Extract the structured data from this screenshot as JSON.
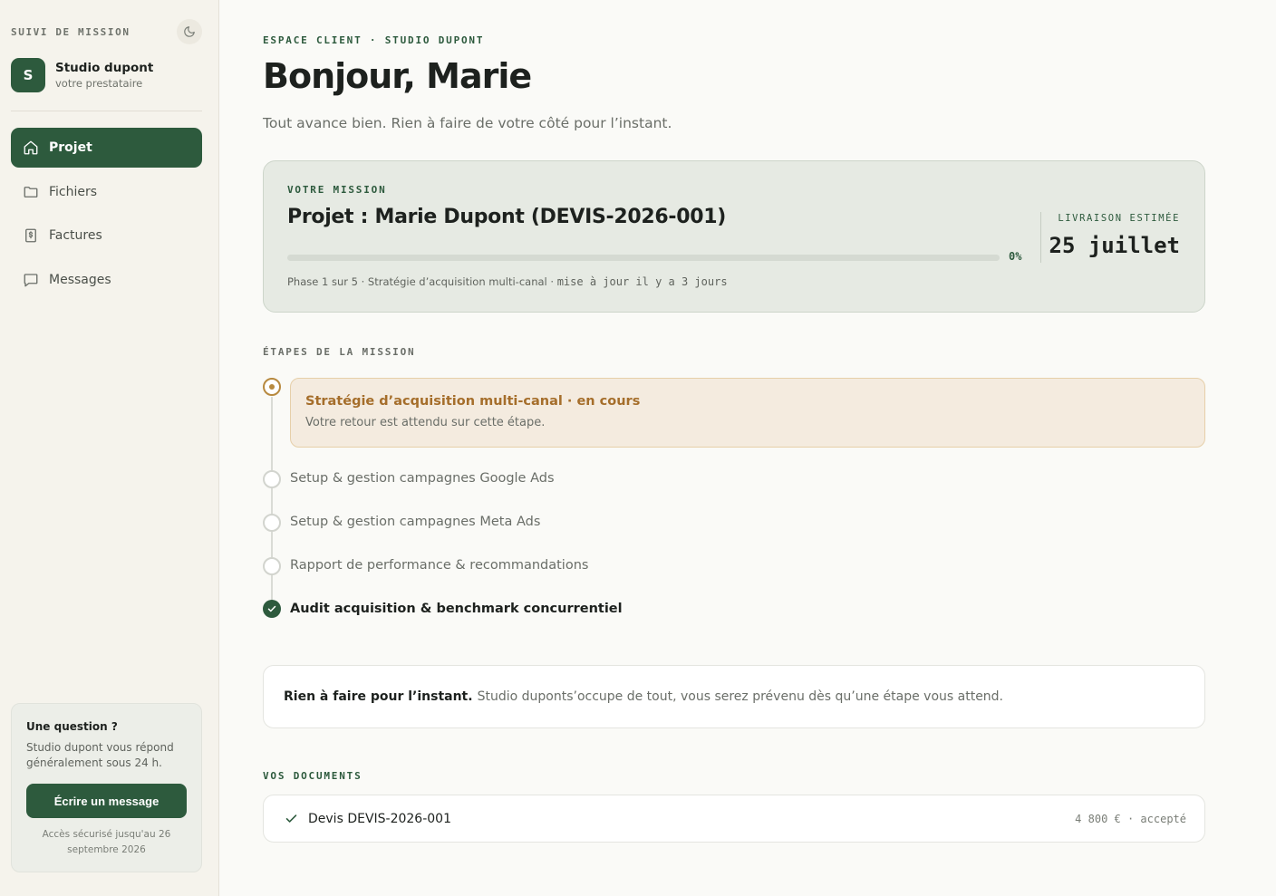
{
  "sidebar": {
    "label": "SUIVI DE MISSION",
    "provider": {
      "initial": "S",
      "name": "Studio dupont",
      "role": "votre prestataire"
    },
    "nav": [
      {
        "label": "Projet",
        "icon": "home-icon",
        "active": true
      },
      {
        "label": "Fichiers",
        "icon": "folder-icon",
        "active": false
      },
      {
        "label": "Factures",
        "icon": "invoice-icon",
        "active": false
      },
      {
        "label": "Messages",
        "icon": "message-icon",
        "active": false
      }
    ],
    "help": {
      "title": "Une question ?",
      "text": "Studio dupont vous répond généralement sous 24 h.",
      "button": "Écrire un message",
      "note": "Accès sécurisé jusqu'au 26 septembre 2026"
    }
  },
  "header": {
    "eyebrow": "ESPACE CLIENT · STUDIO DUPONT",
    "greeting": "Bonjour, Marie",
    "subtitle": "Tout avance bien. Rien à faire de votre côté pour l’instant."
  },
  "mission": {
    "label": "VOTRE MISSION",
    "title": "Projet : Marie Dupont (DEVIS-2026-001)",
    "progress": 0,
    "progress_label": "0%",
    "phase": "Phase 1 sur 5 · Stratégie d’acquisition multi-canal ·",
    "updated": "mise à jour il y a 3 jours",
    "delivery_label": "LIVRAISON ESTIMÉE",
    "delivery_date": "25 juillet"
  },
  "steps": {
    "label": "ÉTAPES DE LA MISSION",
    "current": {
      "title": "Stratégie d’acquisition multi-canal · en cours",
      "subtitle": "Votre retour est attendu sur cette étape."
    },
    "items": [
      {
        "label": "Setup & gestion campagnes Google Ads",
        "status": "pending"
      },
      {
        "label": "Setup & gestion campagnes Meta Ads",
        "status": "pending"
      },
      {
        "label": "Rapport de performance & recommandations",
        "status": "pending"
      },
      {
        "label": "Audit acquisition & benchmark concurrentiel",
        "status": "done"
      }
    ]
  },
  "info": {
    "strong": "Rien à faire pour l’instant.",
    "text": "Studio duponts’occupe de tout, vous serez prévenu dès qu’une étape vous attend."
  },
  "documents": {
    "label": "VOS DOCUMENTS",
    "items": [
      {
        "name": "Devis DEVIS-2026-001",
        "meta": "4 800 € · accepté"
      }
    ]
  },
  "colors": {
    "accent": "#2d5a3d",
    "current": "#b7893f"
  }
}
